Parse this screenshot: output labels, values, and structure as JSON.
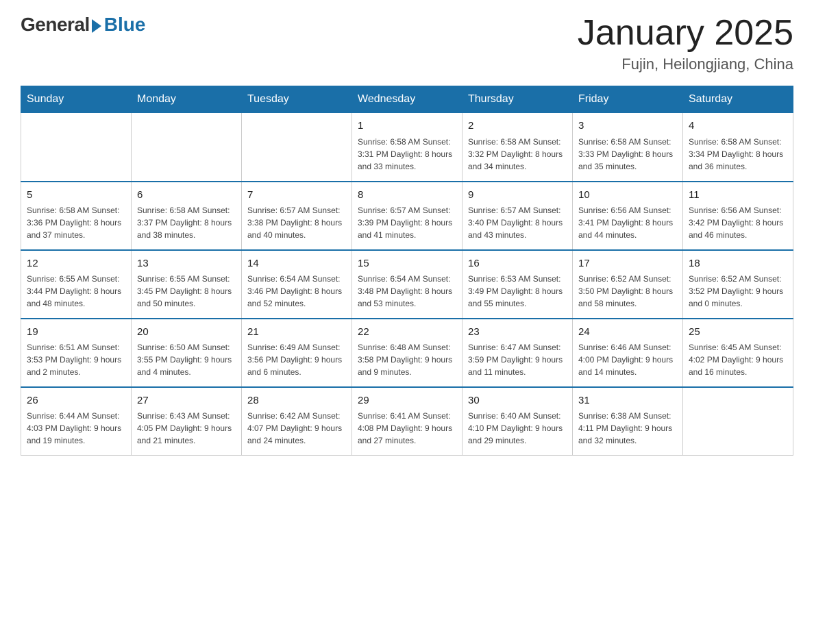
{
  "header": {
    "logo_general": "General",
    "logo_blue": "Blue",
    "title": "January 2025",
    "subtitle": "Fujin, Heilongjiang, China"
  },
  "days_of_week": [
    "Sunday",
    "Monday",
    "Tuesday",
    "Wednesday",
    "Thursday",
    "Friday",
    "Saturday"
  ],
  "weeks": [
    [
      {
        "day": "",
        "info": ""
      },
      {
        "day": "",
        "info": ""
      },
      {
        "day": "",
        "info": ""
      },
      {
        "day": "1",
        "info": "Sunrise: 6:58 AM\nSunset: 3:31 PM\nDaylight: 8 hours\nand 33 minutes."
      },
      {
        "day": "2",
        "info": "Sunrise: 6:58 AM\nSunset: 3:32 PM\nDaylight: 8 hours\nand 34 minutes."
      },
      {
        "day": "3",
        "info": "Sunrise: 6:58 AM\nSunset: 3:33 PM\nDaylight: 8 hours\nand 35 minutes."
      },
      {
        "day": "4",
        "info": "Sunrise: 6:58 AM\nSunset: 3:34 PM\nDaylight: 8 hours\nand 36 minutes."
      }
    ],
    [
      {
        "day": "5",
        "info": "Sunrise: 6:58 AM\nSunset: 3:36 PM\nDaylight: 8 hours\nand 37 minutes."
      },
      {
        "day": "6",
        "info": "Sunrise: 6:58 AM\nSunset: 3:37 PM\nDaylight: 8 hours\nand 38 minutes."
      },
      {
        "day": "7",
        "info": "Sunrise: 6:57 AM\nSunset: 3:38 PM\nDaylight: 8 hours\nand 40 minutes."
      },
      {
        "day": "8",
        "info": "Sunrise: 6:57 AM\nSunset: 3:39 PM\nDaylight: 8 hours\nand 41 minutes."
      },
      {
        "day": "9",
        "info": "Sunrise: 6:57 AM\nSunset: 3:40 PM\nDaylight: 8 hours\nand 43 minutes."
      },
      {
        "day": "10",
        "info": "Sunrise: 6:56 AM\nSunset: 3:41 PM\nDaylight: 8 hours\nand 44 minutes."
      },
      {
        "day": "11",
        "info": "Sunrise: 6:56 AM\nSunset: 3:42 PM\nDaylight: 8 hours\nand 46 minutes."
      }
    ],
    [
      {
        "day": "12",
        "info": "Sunrise: 6:55 AM\nSunset: 3:44 PM\nDaylight: 8 hours\nand 48 minutes."
      },
      {
        "day": "13",
        "info": "Sunrise: 6:55 AM\nSunset: 3:45 PM\nDaylight: 8 hours\nand 50 minutes."
      },
      {
        "day": "14",
        "info": "Sunrise: 6:54 AM\nSunset: 3:46 PM\nDaylight: 8 hours\nand 52 minutes."
      },
      {
        "day": "15",
        "info": "Sunrise: 6:54 AM\nSunset: 3:48 PM\nDaylight: 8 hours\nand 53 minutes."
      },
      {
        "day": "16",
        "info": "Sunrise: 6:53 AM\nSunset: 3:49 PM\nDaylight: 8 hours\nand 55 minutes."
      },
      {
        "day": "17",
        "info": "Sunrise: 6:52 AM\nSunset: 3:50 PM\nDaylight: 8 hours\nand 58 minutes."
      },
      {
        "day": "18",
        "info": "Sunrise: 6:52 AM\nSunset: 3:52 PM\nDaylight: 9 hours\nand 0 minutes."
      }
    ],
    [
      {
        "day": "19",
        "info": "Sunrise: 6:51 AM\nSunset: 3:53 PM\nDaylight: 9 hours\nand 2 minutes."
      },
      {
        "day": "20",
        "info": "Sunrise: 6:50 AM\nSunset: 3:55 PM\nDaylight: 9 hours\nand 4 minutes."
      },
      {
        "day": "21",
        "info": "Sunrise: 6:49 AM\nSunset: 3:56 PM\nDaylight: 9 hours\nand 6 minutes."
      },
      {
        "day": "22",
        "info": "Sunrise: 6:48 AM\nSunset: 3:58 PM\nDaylight: 9 hours\nand 9 minutes."
      },
      {
        "day": "23",
        "info": "Sunrise: 6:47 AM\nSunset: 3:59 PM\nDaylight: 9 hours\nand 11 minutes."
      },
      {
        "day": "24",
        "info": "Sunrise: 6:46 AM\nSunset: 4:00 PM\nDaylight: 9 hours\nand 14 minutes."
      },
      {
        "day": "25",
        "info": "Sunrise: 6:45 AM\nSunset: 4:02 PM\nDaylight: 9 hours\nand 16 minutes."
      }
    ],
    [
      {
        "day": "26",
        "info": "Sunrise: 6:44 AM\nSunset: 4:03 PM\nDaylight: 9 hours\nand 19 minutes."
      },
      {
        "day": "27",
        "info": "Sunrise: 6:43 AM\nSunset: 4:05 PM\nDaylight: 9 hours\nand 21 minutes."
      },
      {
        "day": "28",
        "info": "Sunrise: 6:42 AM\nSunset: 4:07 PM\nDaylight: 9 hours\nand 24 minutes."
      },
      {
        "day": "29",
        "info": "Sunrise: 6:41 AM\nSunset: 4:08 PM\nDaylight: 9 hours\nand 27 minutes."
      },
      {
        "day": "30",
        "info": "Sunrise: 6:40 AM\nSunset: 4:10 PM\nDaylight: 9 hours\nand 29 minutes."
      },
      {
        "day": "31",
        "info": "Sunrise: 6:38 AM\nSunset: 4:11 PM\nDaylight: 9 hours\nand 32 minutes."
      },
      {
        "day": "",
        "info": ""
      }
    ]
  ]
}
